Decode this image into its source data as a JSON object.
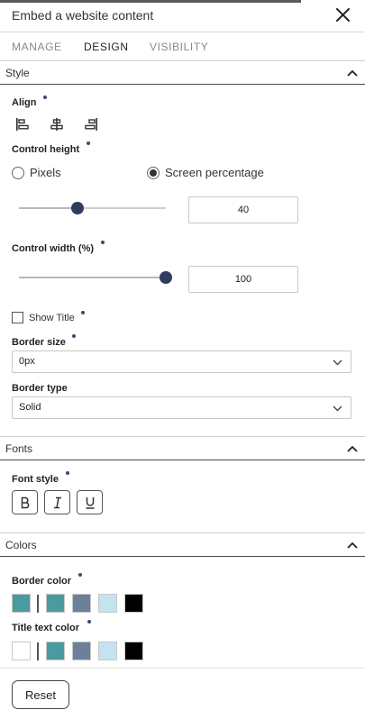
{
  "header": {
    "title": "Embed a website content",
    "close_icon": "close-icon"
  },
  "tabs": [
    {
      "label": "MANAGE",
      "active": false
    },
    {
      "label": "DESIGN",
      "active": true
    },
    {
      "label": "VISIBILITY",
      "active": false
    }
  ],
  "style_section": {
    "title": "Style",
    "align": {
      "label": "Align",
      "options": [
        "align-left-icon",
        "align-center-icon",
        "align-right-icon"
      ]
    },
    "control_height": {
      "label": "Control height",
      "options": [
        {
          "label": "Pixels",
          "selected": false
        },
        {
          "label": "Screen percentage",
          "selected": true
        }
      ],
      "value": "40",
      "slider_fraction": 0.4
    },
    "control_width": {
      "label": "Control width (%)",
      "value": "100",
      "slider_fraction": 1.0
    },
    "show_title": {
      "label": "Show Title",
      "checked": false
    },
    "border_size": {
      "label": "Border size",
      "value": "0px"
    },
    "border_type": {
      "label": "Border type",
      "value": "Solid"
    }
  },
  "fonts_section": {
    "title": "Fonts",
    "font_style": {
      "label": "Font style",
      "buttons": [
        "bold-icon",
        "italic-icon",
        "underline-icon"
      ]
    }
  },
  "colors_section": {
    "title": "Colors",
    "border_color": {
      "label": "Border color",
      "current": "#4a9aa0",
      "palette": [
        "#4a9aa0",
        "#6e7f99",
        "#c3e3f0",
        "#000000"
      ]
    },
    "title_text_color": {
      "label": "Title text color",
      "current": "#ffffff",
      "palette": [
        "#4a9aa0",
        "#6e7f99",
        "#c3e3f0",
        "#000000"
      ]
    }
  },
  "footer": {
    "reset_label": "Reset"
  }
}
